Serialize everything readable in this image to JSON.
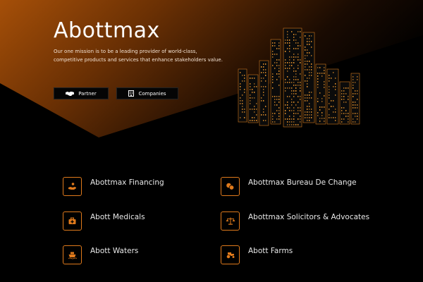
{
  "hero": {
    "title": "Abottmax",
    "mission": "Our one mission is to be a leading provider of world-class, competitive products and services that enhance stakeholders value.",
    "buttons": {
      "partner": "Partner",
      "companies": "Companies"
    }
  },
  "services": [
    {
      "label": "Abottmax Financing",
      "icon": "hand-coin-icon"
    },
    {
      "label": "Abottmax Bureau De Change",
      "icon": "money-exchange-icon"
    },
    {
      "label": "Abott Medicals",
      "icon": "medical-kit-icon"
    },
    {
      "label": "Abottmax Solicitors & Advocates",
      "icon": "balance-scale-icon"
    },
    {
      "label": "Abott Waters",
      "icon": "water-ship-icon"
    },
    {
      "label": "Abott Farms",
      "icon": "tractor-icon"
    }
  ],
  "colors": {
    "accent": "#e07a1c",
    "hero_gradient_start": "#a54f08",
    "hero_gradient_end": "#000000",
    "background": "#000000"
  }
}
